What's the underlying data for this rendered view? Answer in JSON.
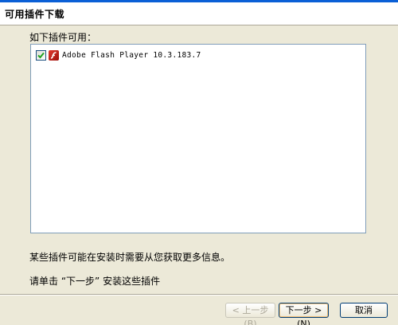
{
  "header": {
    "title": "可用插件下载"
  },
  "main": {
    "available_label": "如下插件可用：",
    "plugins": [
      {
        "checked": true,
        "icon": "flash-icon",
        "name": "Adobe Flash Player 10.3.183.7"
      }
    ],
    "note_more_info": "某些插件可能在安装时需要从您获取更多信息。",
    "note_instruction": "请单击 “下一步” 安装这些插件"
  },
  "buttons": {
    "back_label": "< 上一步(B)",
    "next_label": "下一步 >(N)",
    "cancel_label": "取消"
  },
  "colors": {
    "dialog_bg": "#ece9d8",
    "listbox_border": "#7f9db9",
    "titlebar": "#0a5fd6"
  }
}
